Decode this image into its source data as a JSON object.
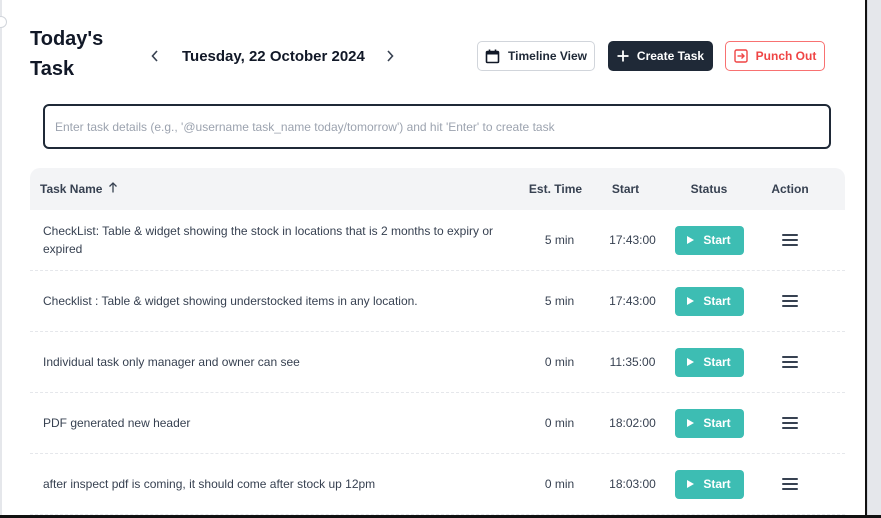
{
  "header": {
    "title": "Today's Task",
    "date": "Tuesday, 22 October 2024",
    "prev_icon": "chevron-left-icon",
    "next_icon": "chevron-right-icon",
    "timeline_label": "Timeline View",
    "create_label": "Create Task",
    "punch_label": "Punch Out"
  },
  "task_input": {
    "placeholder": "Enter task details (e.g., '@username task_name today/tomorrow') and hit 'Enter' to create task",
    "value": ""
  },
  "table": {
    "columns": {
      "name": "Task Name",
      "est": "Est. Time",
      "start": "Start",
      "status": "Status",
      "action": "Action"
    },
    "sort_icon": "arrow-up-icon",
    "rows": [
      {
        "name": "CheckList: Table & widget showing the stock in locations that is 2 months to expiry or expired",
        "est": "5 min",
        "start": "17:43:00",
        "status": "Start"
      },
      {
        "name": "Checklist : Table & widget showing understocked items in any location.",
        "est": "5 min",
        "start": "17:43:00",
        "status": "Start"
      },
      {
        "name": "Individual task only manager and owner can see",
        "est": "0 min",
        "start": "11:35:00",
        "status": "Start"
      },
      {
        "name": "PDF generated new header",
        "est": "0 min",
        "start": "18:02:00",
        "status": "Start"
      },
      {
        "name": "after inspect pdf is coming, it should come after stock up 12pm",
        "est": "0 min",
        "start": "18:03:00",
        "status": "Start"
      }
    ]
  },
  "colors": {
    "start_button": "#3dbdb3",
    "create_button": "#1f2937",
    "punch_out": "#ef4444"
  }
}
